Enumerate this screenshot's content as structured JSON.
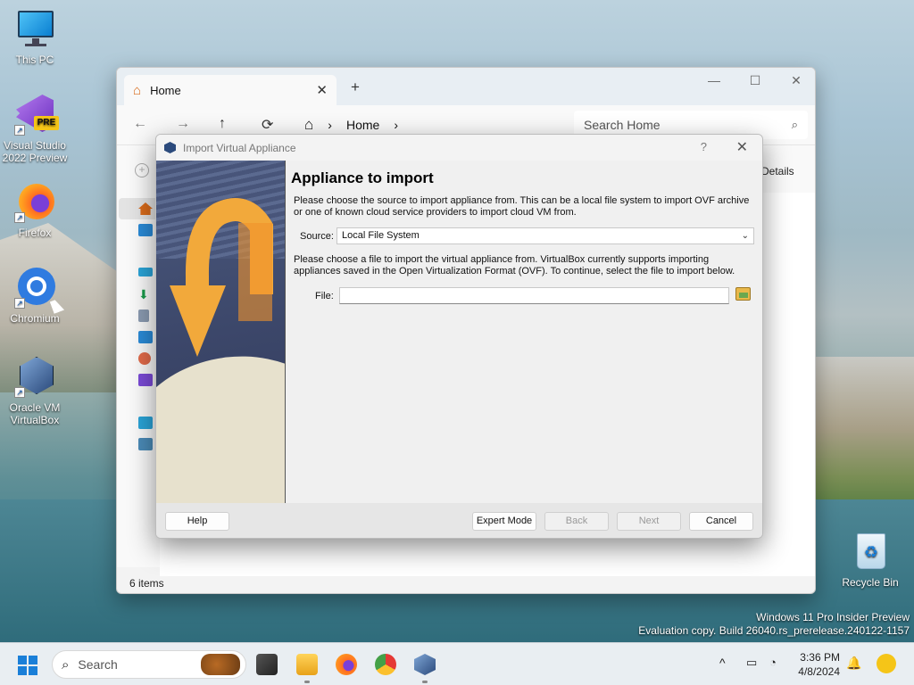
{
  "desktop": {
    "icons": [
      {
        "label_line1": "This PC",
        "label_line2": ""
      },
      {
        "label_line1": "Visual Studio",
        "label_line2": "2022 Preview",
        "badge": "PRE"
      },
      {
        "label_line1": "Firefox",
        "label_line2": ""
      },
      {
        "label_line1": "Chromium",
        "label_line2": ""
      },
      {
        "label_line1": "Oracle VM",
        "label_line2": "VirtualBox"
      },
      {
        "label_line1": "Recycle Bin",
        "label_line2": ""
      }
    ],
    "watermark_line1": "Windows 11 Pro Insider Preview",
    "watermark_line2": "Evaluation copy. Build 26040.rs_prerelease.240122-1157"
  },
  "explorer": {
    "tab_title": "Home",
    "tab_close": "✕",
    "new_tab": "+",
    "window_controls": {
      "minimize": "—",
      "maximize": "☐",
      "close": "✕"
    },
    "nav": {
      "back": "←",
      "forward": "→",
      "up": "↑",
      "refresh": "⟳"
    },
    "breadcrumb": {
      "home_icon": "⌂",
      "sep1": "›",
      "location": "Home",
      "sep2": "›"
    },
    "search_placeholder": "Search Home",
    "search_icon": "⌕",
    "new_icon": "+",
    "details_label": "Details",
    "status": "6 items"
  },
  "dialog": {
    "title": "Import Virtual Appliance",
    "help_glyph": "?",
    "close_glyph": "✕",
    "heading": "Appliance to import",
    "intro": "Please choose the source to import appliance from. This can be a local file system to import OVF archive or one of known cloud service providers to import cloud VM from.",
    "source_label": "Source:",
    "source_value": "Local File System",
    "source_chevron": "⌄",
    "file_intro": "Please choose a file to import the virtual appliance from. VirtualBox currently supports importing appliances saved in the Open Virtualization Format (OVF). To continue, select the file to import below.",
    "file_label": "File:",
    "file_value": "",
    "buttons": {
      "help": "Help",
      "expert": "Expert Mode",
      "back": "Back",
      "next": "Next",
      "cancel": "Cancel"
    }
  },
  "taskbar": {
    "search_label": "Search",
    "search_icon": "⌕",
    "tray_chevron": "^",
    "time": "3:36 PM",
    "date": "4/8/2024",
    "bell": "🔔"
  },
  "colors": {
    "accent": "#1a7fd8",
    "wizard_arrow": "#f2a93b",
    "folder": "#e8b84a"
  }
}
